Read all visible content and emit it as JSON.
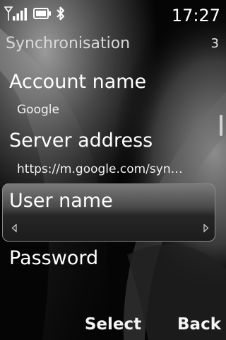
{
  "status_bar": {
    "time": "17:27",
    "icons": [
      "signal-strength-icon",
      "battery-icon",
      "bluetooth-icon"
    ]
  },
  "title_bar": {
    "title": "Synchronisation",
    "page_indicator": "3"
  },
  "settings": {
    "account_name": {
      "label": "Account name",
      "value": "Google"
    },
    "server_address": {
      "label": "Server address",
      "value": "https://m.google.com/syn…"
    },
    "user_name": {
      "label": "User name",
      "value": ""
    },
    "password": {
      "label": "Password"
    }
  },
  "softkeys": {
    "select": "Select",
    "back": "Back"
  },
  "colors": {
    "background": "#000000",
    "text": "#ffffff",
    "highlight_border": "#8a8a8a"
  }
}
